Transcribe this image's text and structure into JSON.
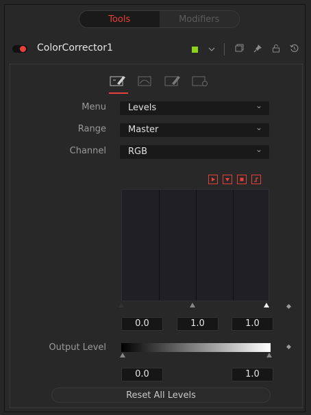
{
  "tabs": [
    {
      "label": "Tools",
      "active": true
    },
    {
      "label": "Modifiers",
      "active": false
    }
  ],
  "header": {
    "node_name": "ColorCorrector1",
    "swatch_color": "#8ed11b",
    "icons": [
      "power-toggle",
      "color-swatch",
      "chevron-down-icon",
      "copy-icon",
      "pin-icon",
      "lock-icon",
      "reset-icon"
    ]
  },
  "subtabs": [
    "controls-icon",
    "ranges-icon",
    "options-icon",
    "settings-icon"
  ],
  "properties": {
    "menu": {
      "label": "Menu",
      "value": "Levels"
    },
    "range": {
      "label": "Range",
      "value": "Master"
    },
    "channel": {
      "label": "Channel",
      "value": "RGB"
    }
  },
  "histogram_controls": [
    "play-icon",
    "dropdown-icon",
    "stop-icon",
    "curve-icon"
  ],
  "input_levels": {
    "low": "0.0",
    "gamma": "1.0",
    "high": "1.0"
  },
  "output_level": {
    "label": "Output Level",
    "low": "0.0",
    "high": "1.0"
  },
  "reset_button": "Reset All Levels",
  "accent_color": "#e8413a"
}
